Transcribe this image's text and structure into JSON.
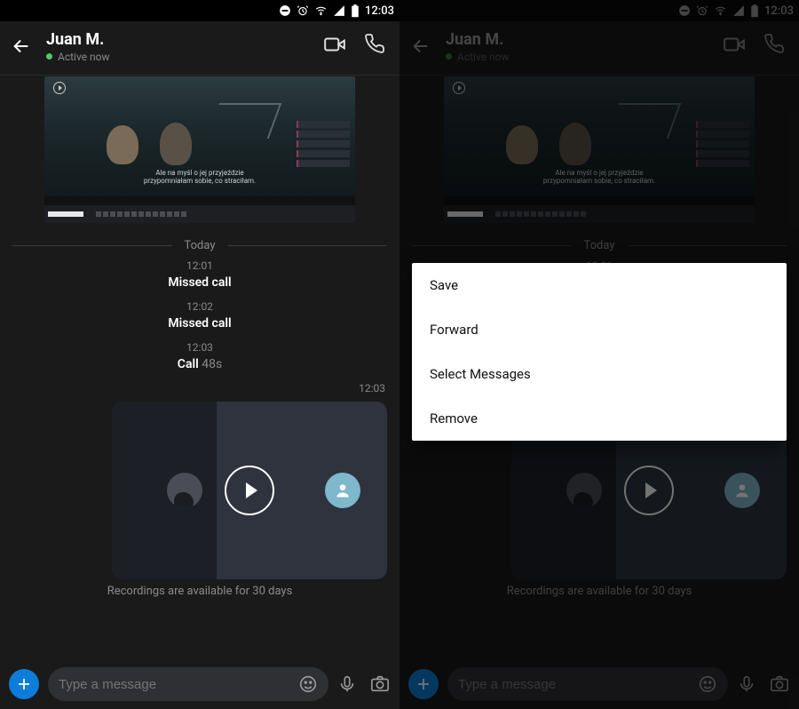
{
  "statusbar": {
    "time": "12:03"
  },
  "chat": {
    "name": "Juan M.",
    "status": "Active now"
  },
  "conversation": {
    "image_subtitle_line1": "Ale na myśl o jej przyjeździe",
    "image_subtitle_line2": "przypomniałam sobie, co straciłam.",
    "date_sep": "Today",
    "calls": [
      {
        "time": "12:01",
        "label": "Missed call",
        "duration": ""
      },
      {
        "time": "12:02",
        "label": "Missed call",
        "duration": ""
      },
      {
        "time": "12:03",
        "label": "Call",
        "duration": "48s"
      }
    ],
    "rec_ts": "12:03",
    "rec_note": "Recordings are available for 30 days"
  },
  "composer": {
    "placeholder": "Type a message"
  },
  "context_menu": {
    "items": [
      "Save",
      "Forward",
      "Select Messages",
      "Remove"
    ]
  }
}
